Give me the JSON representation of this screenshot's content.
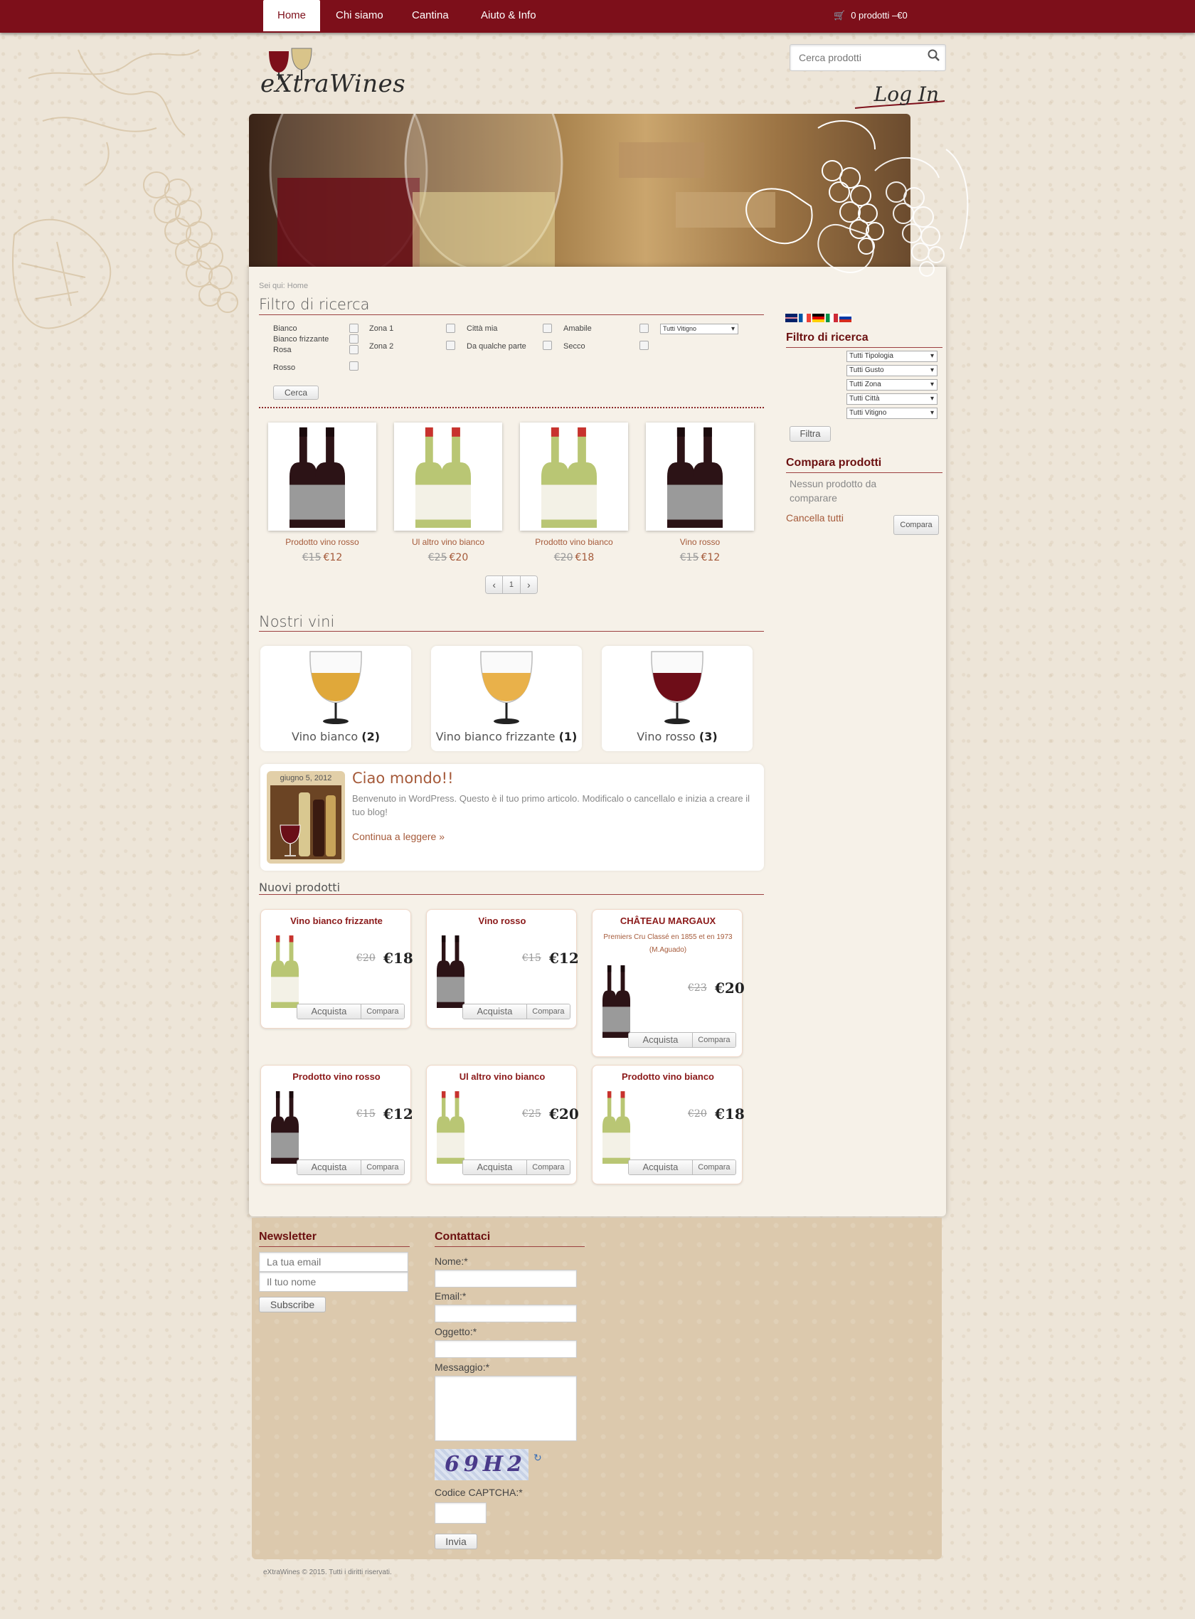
{
  "nav": {
    "items": [
      {
        "label": "Home"
      },
      {
        "label": "Chi siamo"
      },
      {
        "label": "Cantina"
      },
      {
        "label": "Aiuto & Info"
      }
    ],
    "cart_label": "0 prodotti –€0"
  },
  "brand": {
    "logo_text": "eXtraWines"
  },
  "search": {
    "placeholder": "Cerca prodotti"
  },
  "login": {
    "label": "Log In"
  },
  "breadcrumb": "Sei qui: Home",
  "filter": {
    "title": "Filtro di ricerca",
    "types": [
      "Bianco",
      "Bianco frizzante",
      "Rosa",
      "Rosso"
    ],
    "zones": [
      "Zona 1",
      "Zona 2"
    ],
    "cities": [
      "Città mia",
      "Da qualche parte"
    ],
    "tastes": [
      "Amabile",
      "Secco"
    ],
    "vitigno_select": "Tutti Vitigno",
    "button": "Cerca"
  },
  "carousel": {
    "products": [
      {
        "name": "Prodotto vino rosso",
        "old": "€15",
        "new": "€12",
        "wine": "red"
      },
      {
        "name": "Ul altro vino bianco",
        "old": "€25",
        "new": "€20",
        "wine": "white"
      },
      {
        "name": "Prodotto vino bianco",
        "old": "€20",
        "new": "€18",
        "wine": "white"
      },
      {
        "name": "Vino rosso",
        "old": "€15",
        "new": "€12",
        "wine": "red"
      }
    ],
    "pager": {
      "prev": "‹",
      "page": "1",
      "next": "›"
    }
  },
  "our_wines": {
    "title": "Nostri vini",
    "items": [
      {
        "label": "Vino bianco",
        "count": "(2)",
        "color": "#e0a83a"
      },
      {
        "label": "Vino bianco frizzante",
        "count": "(1)",
        "color": "#e9b14a"
      },
      {
        "label": "Vino rosso",
        "count": "(3)",
        "color": "#6e0d18"
      }
    ]
  },
  "post": {
    "date": "giugno 5, 2012",
    "title": "Ciao mondo!!",
    "body": "Benvenuto in WordPress. Questo è il tuo primo articolo. Modificalo o cancellalo e inizia a creare il tuo blog!",
    "more": "Continua a leggere »"
  },
  "new_products": {
    "title": "Nuovi prodotti",
    "buy": "Acquista",
    "compare": "Compara",
    "items": [
      {
        "name": "Vino bianco frizzante",
        "sub": "",
        "old": "€20",
        "new": "€18",
        "wine": "white"
      },
      {
        "name": "Vino rosso",
        "sub": "",
        "old": "€15",
        "new": "€12",
        "wine": "red"
      },
      {
        "name": "CHÂTEAU MARGAUX",
        "sub": "Premiers Cru Classé en 1855 et en 1973 (M.Aguado)",
        "old": "€23",
        "new": "€20",
        "wine": "red"
      },
      {
        "name": "Prodotto vino rosso",
        "sub": "",
        "old": "€15",
        "new": "€12",
        "wine": "red"
      },
      {
        "name": "Ul altro vino bianco",
        "sub": "",
        "old": "€25",
        "new": "€20",
        "wine": "white"
      },
      {
        "name": "Prodotto vino bianco",
        "sub": "",
        "old": "€20",
        "new": "€18",
        "wine": "white"
      }
    ]
  },
  "sidebar": {
    "filter_title": "Filtro di ricerca",
    "selects": [
      "Tutti Tipologia",
      "Tutti Gusto",
      "Tutti Zona",
      "Tutti Città",
      "Tutti Vitigno"
    ],
    "filter_button": "Filtra",
    "compare_title": "Compara prodotti",
    "compare_empty": "Nessun prodotto da comparare",
    "clear_all": "Cancella tutti",
    "compare_button": "Compara"
  },
  "newsletter": {
    "title": "Newsletter",
    "email_placeholder": "La tua email",
    "name_placeholder": "Il tuo nome",
    "button": "Subscribe"
  },
  "contact": {
    "title": "Contattaci",
    "name_label": "Nome:*",
    "email_label": "Email:*",
    "subject_label": "Oggetto:*",
    "message_label": "Messaggio:*",
    "captcha_text": "69H2",
    "captcha_label": "Codice CAPTCHA:*",
    "button": "Invia"
  },
  "footer": {
    "copyright": "eXtraWines © 2015. Tutti i diritti riservati."
  },
  "colors": {
    "brand": "#7d0f1a",
    "accent": "#a55a3a",
    "heading": "#6b1010"
  }
}
